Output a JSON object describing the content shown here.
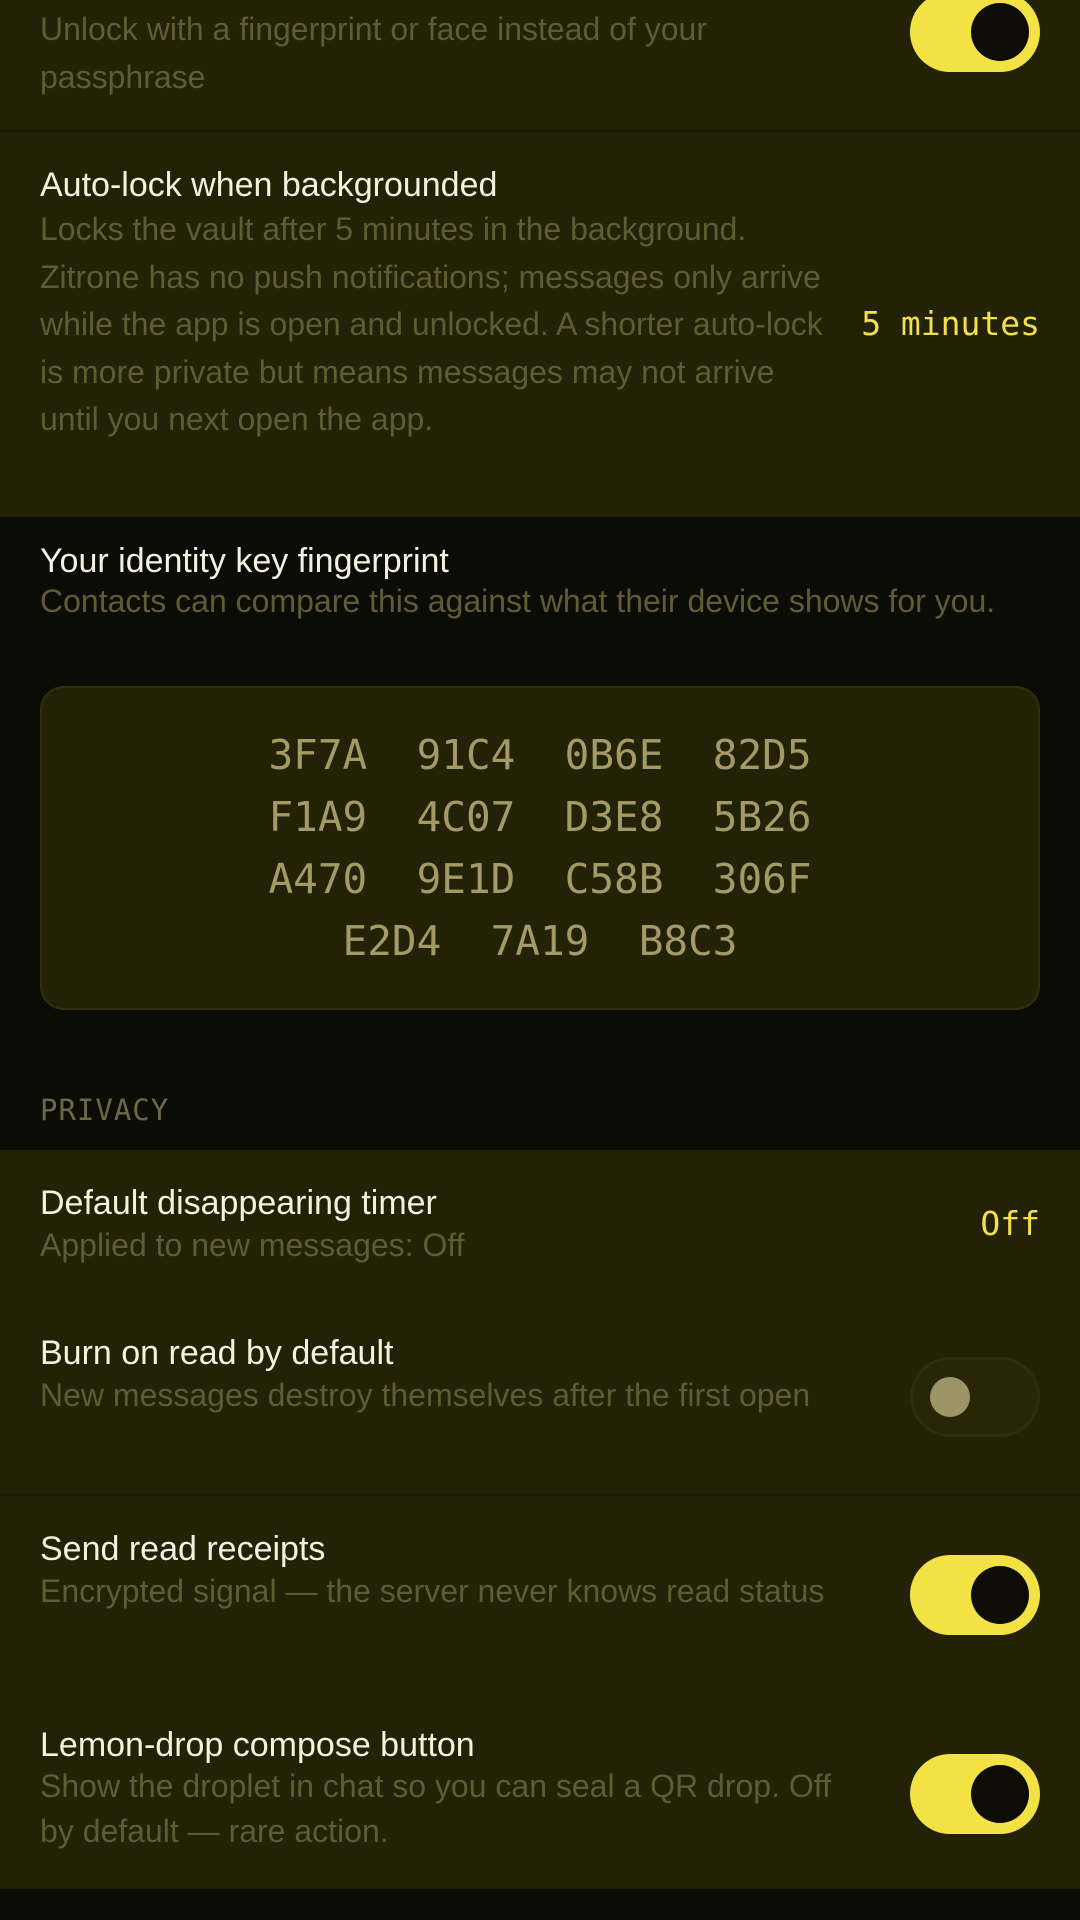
{
  "security": {
    "biometric": {
      "description": "Unlock with a fingerprint or face instead of your passphrase",
      "enabled": true
    },
    "auto_lock": {
      "title": "Auto-lock when backgrounded",
      "description": "Locks the vault after 5 minutes in the background. Zitrone has no push notifications; messages only arrive while the app is open and unlocked. A shorter auto-lock is more private but means messages may not arrive until you next open the app.",
      "value": "5 minutes"
    }
  },
  "identity": {
    "title": "Your identity key fingerprint",
    "description": "Contacts can compare this against what their device shows for you.",
    "fingerprint_lines": [
      "3F7A  91C4  0B6E  82D5",
      "F1A9  4C07  D3E8  5B26",
      "A470  9E1D  C58B  306F",
      "E2D4  7A19  B8C3"
    ]
  },
  "privacy": {
    "section_label": "PRIVACY",
    "disappearing_timer": {
      "title": "Default disappearing timer",
      "description": "Applied to new messages: Off",
      "value": "Off"
    },
    "burn_on_read": {
      "title": "Burn on read by default",
      "description": "New messages destroy themselves after the first open",
      "enabled": false
    },
    "read_receipts": {
      "title": "Send read receipts",
      "description": "Encrypted signal — the server never knows read status",
      "enabled": true
    },
    "lemon_drop": {
      "title": "Lemon-drop compose button",
      "description": "Show the droplet in chat so you can seal a QR drop. Off by default — rare action.",
      "enabled": true
    }
  },
  "colors": {
    "background": "#0c0c06",
    "card": "#232106",
    "accent": "#f2e244",
    "title_text": "#f4f1df",
    "muted_text": "#5f5b33",
    "fingerprint_text": "#a39a66"
  }
}
